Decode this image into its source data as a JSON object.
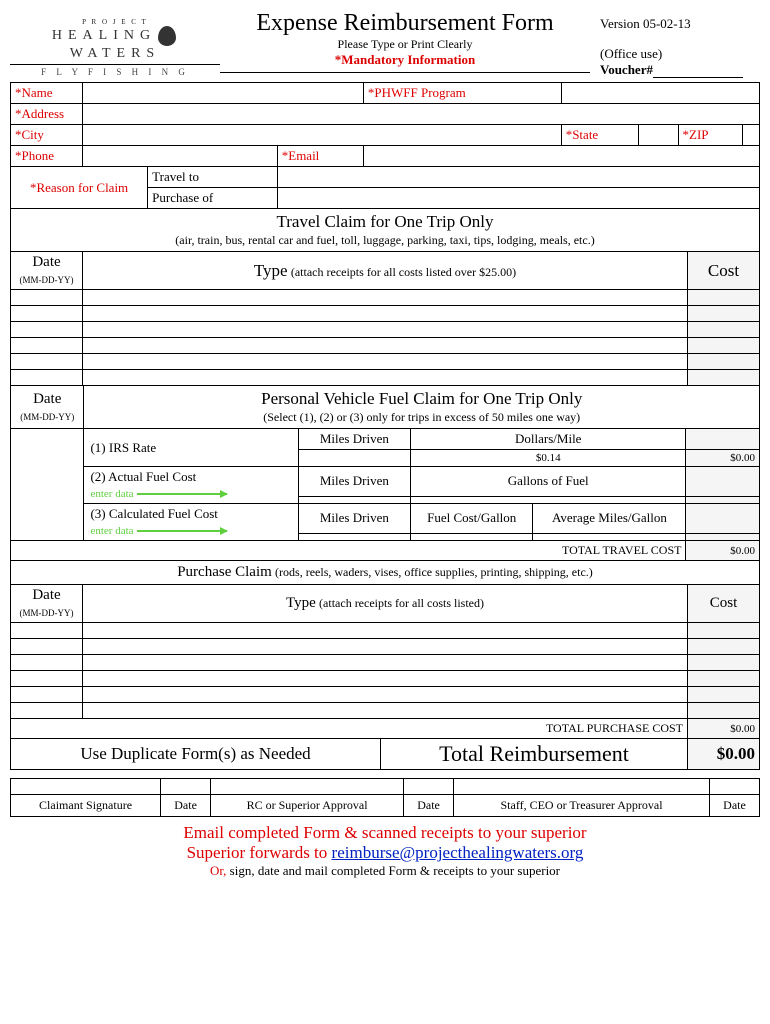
{
  "header": {
    "logo_project": "P R O J E C T",
    "logo_main_left": "HEALING",
    "logo_main_right": "WATERS",
    "logo_sub": "F L Y F I S H I N G",
    "title": "Expense Reimbursement Form",
    "subtitle": "Please Type or Print Clearly",
    "mandatory": "*Mandatory Information",
    "version": "Version 05-02-13",
    "office_use": "(Office use)",
    "voucher_label": "Voucher#"
  },
  "info": {
    "name": "*Name",
    "program": "*PHWFF Program",
    "address": "*Address",
    "city": "*City",
    "state": "*State",
    "zip": "*ZIP",
    "phone": "*Phone",
    "email": "*Email",
    "reason": "*Reason for Claim",
    "travel_to": "Travel to",
    "purchase_of": "Purchase of"
  },
  "travel": {
    "heading": "Travel Claim for One Trip Only",
    "sub": "(air, train, bus, rental car and fuel, toll, luggage, parking, taxi, tips, lodging, meals, etc.)",
    "date_col": "Date",
    "date_sub": "(MM-DD-YY)",
    "type_col": "Type",
    "type_sub": "(attach receipts for all costs listed over $25.00)",
    "cost_col": "Cost"
  },
  "fuel": {
    "date_col": "Date",
    "date_sub": "(MM-DD-YY)",
    "heading": "Personal Vehicle Fuel Claim for One Trip Only",
    "sub": "(Select (1), (2) or (3) only for trips in excess of 50 miles one way)",
    "opt1": "(1) IRS Rate",
    "opt2": "(2) Actual Fuel Cost",
    "opt3": "(3) Calculated Fuel Cost",
    "enter_data": "enter data",
    "miles_driven": "Miles Driven",
    "dollars_mile": "Dollars/Mile",
    "rate": "$0.14",
    "gallons_fuel": "Gallons of Fuel",
    "fuel_cost_gallon": "Fuel Cost/Gallon",
    "avg_mpg": "Average Miles/Gallon",
    "total_travel": "TOTAL TRAVEL COST",
    "zero": "$0.00",
    "zero2": "$0.00"
  },
  "purchase": {
    "heading": "Purchase Claim",
    "sub": "(rods, reels, waders, vises, office supplies, printing, shipping, etc.)",
    "date_col": "Date",
    "date_sub": "(MM-DD-YY)",
    "type_col": "Type",
    "type_sub": "(attach receipts for all costs listed)",
    "cost_col": "Cost",
    "total_purchase": "TOTAL PURCHASE COST",
    "zero": "$0.00"
  },
  "totals": {
    "dup": "Use Duplicate Form(s) as Needed",
    "total_label": "Total Reimbursement",
    "total_value": "$0.00"
  },
  "sig": {
    "claimant": "Claimant Signature",
    "date": "Date",
    "rc": "RC or Superior Approval",
    "staff": "Staff, CEO or Treasurer Approval"
  },
  "footer": {
    "line1": "Email completed Form & scanned receipts to your superior",
    "line2a": "Superior forwards to ",
    "line2b": "reimburse@projecthealingwaters.org",
    "or": "Or,",
    "line3": " sign, date and mail completed Form & receipts to your superior"
  }
}
